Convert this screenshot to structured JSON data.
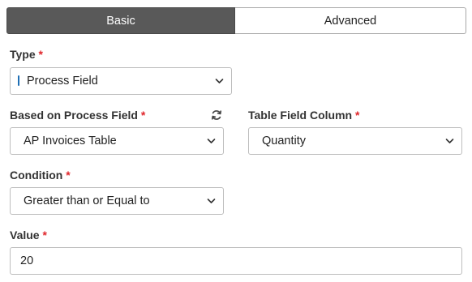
{
  "tabs": {
    "basic_label": "Basic",
    "advanced_label": "Advanced",
    "active": "Basic"
  },
  "type_field": {
    "label": "Type",
    "required_mark": "*",
    "value": "Process Field"
  },
  "based_on_field": {
    "label": "Based on Process Field",
    "required_mark": "*",
    "value": "AP Invoices Table"
  },
  "table_column_field": {
    "label": "Table Field Column",
    "required_mark": "*",
    "value": "Quantity"
  },
  "condition_field": {
    "label": "Condition",
    "required_mark": "*",
    "value": "Greater than or Equal to"
  },
  "value_field": {
    "label": "Value",
    "required_mark": "*",
    "value": "20"
  },
  "icons": {
    "refresh": "refresh-icon",
    "dropdown": "chevron-down-icon"
  },
  "colors": {
    "active_tab_bg": "#595959",
    "required_mark": "#e0262b",
    "type_indicator": "#1f6fb5",
    "border": "#bdbdbd"
  }
}
